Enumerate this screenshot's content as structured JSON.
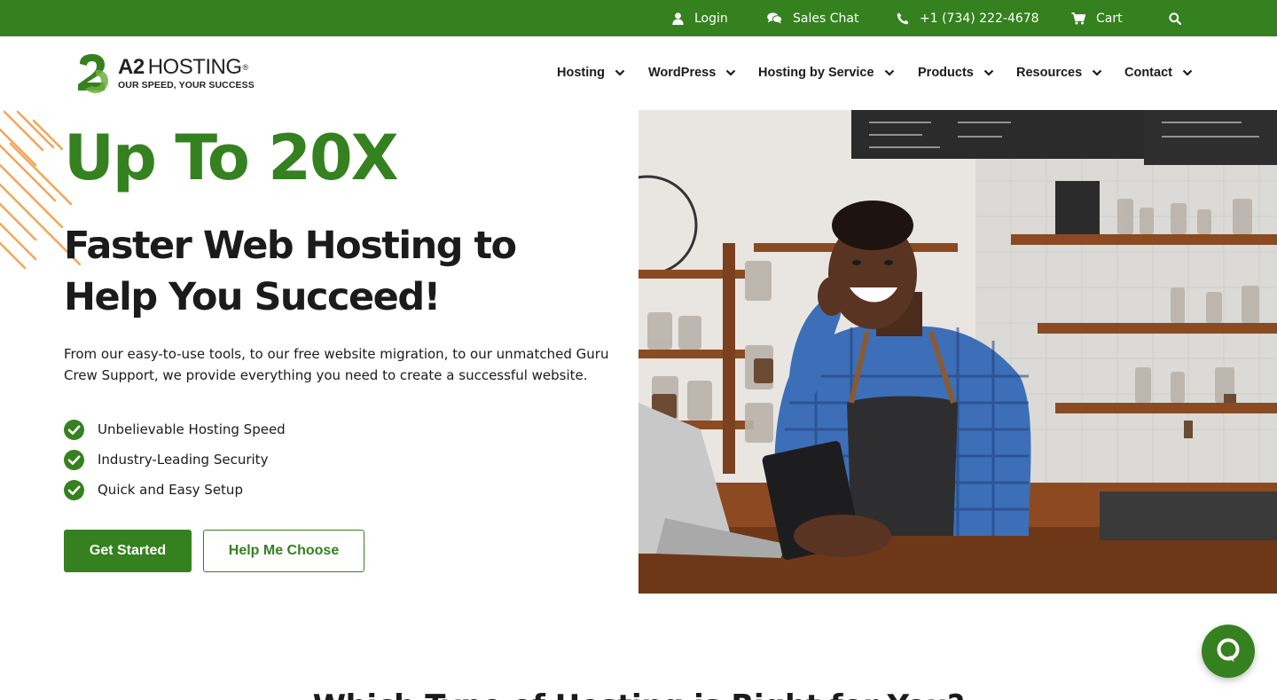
{
  "topbar": {
    "login_label": "Login",
    "chat_label": "Sales Chat",
    "phone_label": "+1 (734) 222-4678",
    "cart_label": "Cart",
    "icons": [
      "user-icon",
      "chat-icon",
      "phone-icon",
      "cart-icon",
      "search-icon"
    ]
  },
  "brand": {
    "name_bold": "A2",
    "name_rest": "HOSTING",
    "registered": "®",
    "tagline": "OUR SPEED, YOUR SUCCESS"
  },
  "nav": {
    "items": [
      {
        "label": "Hosting"
      },
      {
        "label": "WordPress"
      },
      {
        "label": "Hosting by Service"
      },
      {
        "label": "Products"
      },
      {
        "label": "Resources"
      },
      {
        "label": "Contact"
      }
    ]
  },
  "hero": {
    "title": "Up To 20X",
    "subtitle": "Faster Web Hosting to Help You Succeed!",
    "description": "From our easy-to-use tools, to our free website migration, to our unmatched Guru Crew Support, we provide everything you need to create a successful website.",
    "features": [
      "Unbelievable Hosting Speed",
      "Industry-Leading Security",
      "Quick and Easy Setup"
    ],
    "primary_button": "Get Started",
    "secondary_button": "Help Me Choose"
  },
  "next_section": {
    "heading": "Which Type of Hosting is Right for You?"
  },
  "colors": {
    "brand_green": "#35811f",
    "text_dark": "#1b1b1b",
    "stripe_orange": "#f2a65a"
  }
}
